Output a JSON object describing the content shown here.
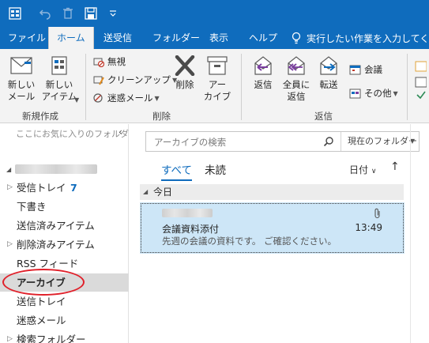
{
  "tabs": [
    "ファイル",
    "ホーム",
    "送受信",
    "フォルダー",
    "表示",
    "ヘルプ"
  ],
  "tell_me": "実行したい作業を入力してくだ",
  "ribbon": {
    "new_mail": "新しい\nメール",
    "new_item": "新しい\nアイテム",
    "ignore": "無視",
    "cleanup": "クリーンアップ",
    "junk": "迷惑メール",
    "delete": "削除",
    "archive": "アー\nカイブ",
    "reply": "返信",
    "reply_all": "全員に\n返信",
    "forward": "転送",
    "meeting": "会議",
    "more": "その他",
    "group_new": "新規作成",
    "group_delete": "削除",
    "group_respond": "返信"
  },
  "folder_pane": {
    "fav_hint": "ここにお気に入りのフォルダ",
    "folders": [
      {
        "label": "受信トレイ",
        "count": "7",
        "arrow": true
      },
      {
        "label": "下書き",
        "count": "",
        "arrow": false
      },
      {
        "label": "送信済みアイテム",
        "count": "",
        "arrow": false
      },
      {
        "label": "削除済みアイテム",
        "count": "",
        "arrow": true
      },
      {
        "label": "RSS フィード",
        "count": "",
        "arrow": false
      },
      {
        "label": "アーカイブ",
        "count": "",
        "arrow": false,
        "selected": true
      },
      {
        "label": "送信トレイ",
        "count": "",
        "arrow": false
      },
      {
        "label": "迷惑メール",
        "count": "",
        "arrow": false
      },
      {
        "label": "検索フォルダー",
        "count": "",
        "arrow": true
      }
    ]
  },
  "message_list": {
    "search_placeholder": "アーカイブの検索",
    "search_scope": "現在のフォルダー",
    "filter_all": "すべて",
    "filter_unread": "未読",
    "sort_label": "日付",
    "group_today": "今日",
    "message": {
      "subject": "会議資料添付",
      "time": "13:49",
      "preview": "先週の会議の資料です。 ご確認ください。"
    }
  },
  "colors": {
    "accent": "#0f6cbd",
    "selection": "#cde6f7",
    "highlight_circle": "#e0202a"
  }
}
